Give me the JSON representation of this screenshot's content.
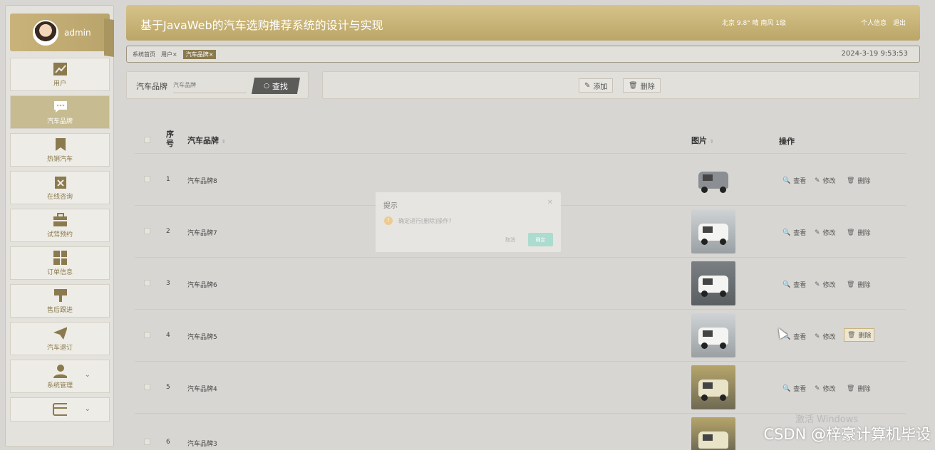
{
  "user": {
    "name": "admin"
  },
  "sidebar": {
    "items": [
      {
        "label": "用户",
        "icon": "chart-line-icon",
        "active": false
      },
      {
        "label": "汽车品牌",
        "icon": "chat-bubble-icon",
        "active": true
      },
      {
        "label": "热销汽车",
        "icon": "bookmark-icon",
        "active": false
      },
      {
        "label": "在线咨询",
        "icon": "clipboard-x-icon",
        "active": false
      },
      {
        "label": "试驾预约",
        "icon": "briefcase-icon",
        "active": false
      },
      {
        "label": "订单信息",
        "icon": "grid-icon",
        "active": false
      },
      {
        "label": "售后跟进",
        "icon": "brush-icon",
        "active": false
      },
      {
        "label": "汽车退订",
        "icon": "paper-plane-icon",
        "active": false
      },
      {
        "label": "系统管理",
        "icon": "person-icon",
        "active": false
      },
      {
        "label": "",
        "icon": "card-icon",
        "active": false
      }
    ]
  },
  "header": {
    "title": "基于JavaWeb的汽车选购推荐系统的设计与实现",
    "weather": "北京  9.8°  晴  南风  1级",
    "profile_link": "个人信息",
    "logout_link": "退出"
  },
  "tabs": {
    "items": [
      "系统首页",
      "用户×",
      "汽车品牌×"
    ],
    "datetime": "2024-3-19 9:53:53"
  },
  "search": {
    "label": "汽车品牌",
    "placeholder": "汽车品牌",
    "button": "查找"
  },
  "actions": {
    "add": "添加",
    "delete": "删除"
  },
  "table": {
    "headers": {
      "index": "序号",
      "brand": "汽车品牌",
      "image": "图片",
      "ops": "操作"
    },
    "rows": [
      {
        "index": "1",
        "brand": "汽车品牌8"
      },
      {
        "index": "2",
        "brand": "汽车品牌7"
      },
      {
        "index": "3",
        "brand": "汽车品牌6"
      },
      {
        "index": "4",
        "brand": "汽车品牌5"
      },
      {
        "index": "5",
        "brand": "汽车品牌4"
      },
      {
        "index": "6",
        "brand": "汽车品牌3"
      }
    ],
    "ops": {
      "view": "查看",
      "edit": "修改",
      "delete": "删除"
    }
  },
  "modal": {
    "title": "提示",
    "message": "确定进行[删除]操作?",
    "cancel": "取消",
    "ok": "确定"
  },
  "watermarks": {
    "activate": "激活 Windows",
    "csdn": "CSDN @梓豪计算机毕设"
  },
  "colors": {
    "accent": "#c9b37a",
    "active_tab": "#8a7a4e",
    "ok_button": "#a9dccf"
  }
}
